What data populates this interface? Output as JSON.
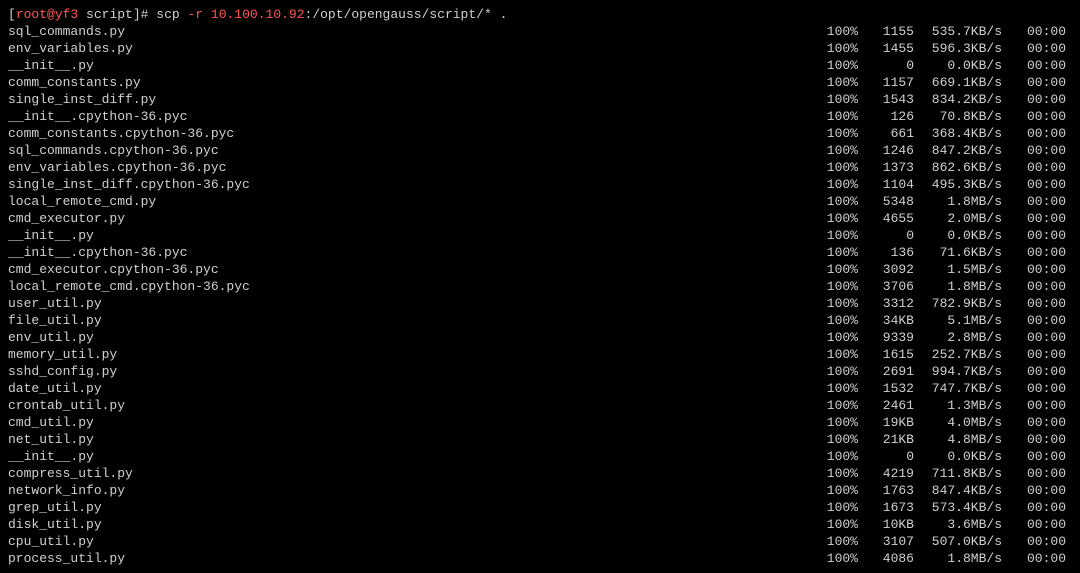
{
  "prompt": {
    "bracket_open": "[",
    "user_host": "root@yf3",
    "space1": " ",
    "cwd": "script",
    "bracket_close": "]",
    "hash": "# ",
    "cmd": "scp ",
    "option": "-r ",
    "ip": "10.100.10.92",
    "remote_path": ":/opt/opengauss/script/* ."
  },
  "rows": [
    {
      "file": "sql_commands.py",
      "pct": "100%",
      "size": "1155",
      "speed": "535.7KB/s",
      "time": "00:00"
    },
    {
      "file": "env_variables.py",
      "pct": "100%",
      "size": "1455",
      "speed": "596.3KB/s",
      "time": "00:00"
    },
    {
      "file": "__init__.py",
      "pct": "100%",
      "size": "0",
      "speed": "0.0KB/s",
      "time": "00:00"
    },
    {
      "file": "comm_constants.py",
      "pct": "100%",
      "size": "1157",
      "speed": "669.1KB/s",
      "time": "00:00"
    },
    {
      "file": "single_inst_diff.py",
      "pct": "100%",
      "size": "1543",
      "speed": "834.2KB/s",
      "time": "00:00"
    },
    {
      "file": "__init__.cpython-36.pyc",
      "pct": "100%",
      "size": "126",
      "speed": "70.8KB/s",
      "time": "00:00"
    },
    {
      "file": "comm_constants.cpython-36.pyc",
      "pct": "100%",
      "size": "661",
      "speed": "368.4KB/s",
      "time": "00:00"
    },
    {
      "file": "sql_commands.cpython-36.pyc",
      "pct": "100%",
      "size": "1246",
      "speed": "847.2KB/s",
      "time": "00:00"
    },
    {
      "file": "env_variables.cpython-36.pyc",
      "pct": "100%",
      "size": "1373",
      "speed": "862.6KB/s",
      "time": "00:00"
    },
    {
      "file": "single_inst_diff.cpython-36.pyc",
      "pct": "100%",
      "size": "1104",
      "speed": "495.3KB/s",
      "time": "00:00"
    },
    {
      "file": "local_remote_cmd.py",
      "pct": "100%",
      "size": "5348",
      "speed": "1.8MB/s",
      "time": "00:00"
    },
    {
      "file": "cmd_executor.py",
      "pct": "100%",
      "size": "4655",
      "speed": "2.0MB/s",
      "time": "00:00"
    },
    {
      "file": "__init__.py",
      "pct": "100%",
      "size": "0",
      "speed": "0.0KB/s",
      "time": "00:00"
    },
    {
      "file": "__init__.cpython-36.pyc",
      "pct": "100%",
      "size": "136",
      "speed": "71.6KB/s",
      "time": "00:00"
    },
    {
      "file": "cmd_executor.cpython-36.pyc",
      "pct": "100%",
      "size": "3092",
      "speed": "1.5MB/s",
      "time": "00:00"
    },
    {
      "file": "local_remote_cmd.cpython-36.pyc",
      "pct": "100%",
      "size": "3706",
      "speed": "1.8MB/s",
      "time": "00:00"
    },
    {
      "file": "user_util.py",
      "pct": "100%",
      "size": "3312",
      "speed": "782.9KB/s",
      "time": "00:00"
    },
    {
      "file": "file_util.py",
      "pct": "100%",
      "size": "34KB",
      "speed": "5.1MB/s",
      "time": "00:00"
    },
    {
      "file": "env_util.py",
      "pct": "100%",
      "size": "9339",
      "speed": "2.8MB/s",
      "time": "00:00"
    },
    {
      "file": "memory_util.py",
      "pct": "100%",
      "size": "1615",
      "speed": "252.7KB/s",
      "time": "00:00"
    },
    {
      "file": "sshd_config.py",
      "pct": "100%",
      "size": "2691",
      "speed": "994.7KB/s",
      "time": "00:00"
    },
    {
      "file": "date_util.py",
      "pct": "100%",
      "size": "1532",
      "speed": "747.7KB/s",
      "time": "00:00"
    },
    {
      "file": "crontab_util.py",
      "pct": "100%",
      "size": "2461",
      "speed": "1.3MB/s",
      "time": "00:00"
    },
    {
      "file": "cmd_util.py",
      "pct": "100%",
      "size": "19KB",
      "speed": "4.0MB/s",
      "time": "00:00"
    },
    {
      "file": "net_util.py",
      "pct": "100%",
      "size": "21KB",
      "speed": "4.8MB/s",
      "time": "00:00"
    },
    {
      "file": "__init__.py",
      "pct": "100%",
      "size": "0",
      "speed": "0.0KB/s",
      "time": "00:00"
    },
    {
      "file": "compress_util.py",
      "pct": "100%",
      "size": "4219",
      "speed": "711.8KB/s",
      "time": "00:00"
    },
    {
      "file": "network_info.py",
      "pct": "100%",
      "size": "1763",
      "speed": "847.4KB/s",
      "time": "00:00"
    },
    {
      "file": "grep_util.py",
      "pct": "100%",
      "size": "1673",
      "speed": "573.4KB/s",
      "time": "00:00"
    },
    {
      "file": "disk_util.py",
      "pct": "100%",
      "size": "10KB",
      "speed": "3.6MB/s",
      "time": "00:00"
    },
    {
      "file": "cpu_util.py",
      "pct": "100%",
      "size": "3107",
      "speed": "507.0KB/s",
      "time": "00:00"
    },
    {
      "file": "process_util.py",
      "pct": "100%",
      "size": "4086",
      "speed": "1.8MB/s",
      "time": "00:00"
    }
  ]
}
